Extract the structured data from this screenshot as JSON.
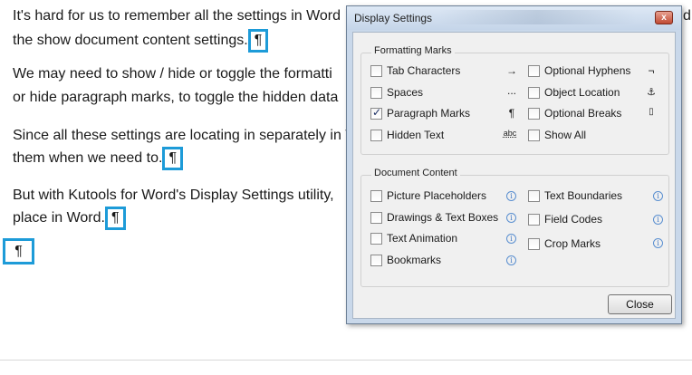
{
  "document": {
    "lines": [
      "It's hard for us to remember all the settings in Word",
      "the show document content settings.",
      "We may need to show / hide  or toggle the formatti",
      "or hide  paragraph marks, to toggle the hidden data",
      "Since all these settings are locating in separately in W",
      "them when we need to.",
      " But with Kutools for Word's Display Settings utility,",
      "place in Word."
    ],
    "edge_char": "d",
    "pilcrow": "¶"
  },
  "dialog": {
    "title": "Display Settings",
    "close_glyph": "x",
    "formatting_marks": {
      "title": "Formatting Marks",
      "left": [
        {
          "label": "Tab Characters",
          "checked": false,
          "glyph": "→"
        },
        {
          "label": "Spaces",
          "checked": false,
          "glyph": "..."
        },
        {
          "label": "Paragraph Marks",
          "checked": true,
          "glyph": "¶"
        },
        {
          "label": "Hidden Text",
          "checked": false,
          "glyph": "abc"
        }
      ],
      "right": [
        {
          "label": "Optional Hyphens",
          "checked": false,
          "glyph": "¬"
        },
        {
          "label": "Object Location",
          "checked": false,
          "glyph": "⚓"
        },
        {
          "label": "Optional Breaks",
          "checked": false,
          "glyph": "▯"
        },
        {
          "label": "Show All",
          "checked": false,
          "glyph": ""
        }
      ]
    },
    "document_content": {
      "title": "Document Content",
      "left": [
        {
          "label": "Picture Placeholders",
          "checked": false
        },
        {
          "label": "Drawings & Text Boxes",
          "checked": false
        },
        {
          "label": "Text Animation",
          "checked": false
        },
        {
          "label": "Bookmarks",
          "checked": false
        }
      ],
      "right": [
        {
          "label": "Text Boundaries",
          "checked": false
        },
        {
          "label": "Field Codes",
          "checked": false
        },
        {
          "label": "Crop Marks",
          "checked": false
        }
      ],
      "info_glyph": "i"
    },
    "close_button": "Close"
  }
}
